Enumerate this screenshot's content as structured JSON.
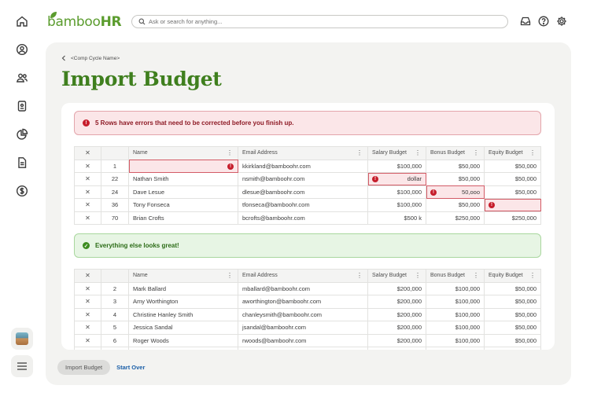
{
  "app": {
    "logo_text": "bamboo",
    "logo_hr": "HR",
    "search_placeholder": "Ask or search for anything..."
  },
  "rail": {
    "icons": [
      "home-icon",
      "person-circle-icon",
      "people-icon",
      "badge-icon",
      "pie-chart-icon",
      "document-icon",
      "dollar-circle-icon"
    ],
    "bottom": [
      "avatar",
      "hamburger-menu-icon"
    ]
  },
  "topbar": {
    "icons": [
      "inbox-icon",
      "help-icon",
      "settings-gear-icon"
    ]
  },
  "breadcrumb": "<Comp Cycle Name>",
  "page_title": "Import Budget",
  "error_alert": "5 Rows have errors that need to be corrected before you finish up.",
  "success_alert": "Everything else looks great!",
  "columns": {
    "name": "Name",
    "email": "Email Address",
    "salary": "Salary Budget",
    "bonus": "Bonus Budget",
    "equity": "Equity Budget"
  },
  "error_rows": [
    {
      "n": "1",
      "name": "",
      "email": "kkirkland@bamboohr.com",
      "salary": "$100,000",
      "bonus": "$50,000",
      "equity": "$50,000"
    },
    {
      "n": "22",
      "name": "Nathan Smith",
      "email": "nsmith@bamboohr.com",
      "salary": "dollar",
      "bonus": "$50,000",
      "equity": "$50,000"
    },
    {
      "n": "24",
      "name": "Dave Lesue",
      "email": "dlesue@bamboohr.com",
      "salary": "$100,000",
      "bonus": "50,ooo",
      "equity": "$50,000"
    },
    {
      "n": "36",
      "name": "Tony Fonseca",
      "email": "tfonseca@bamboohr.com",
      "salary": "$100,000",
      "bonus": "$50,000",
      "equity": ""
    },
    {
      "n": "70",
      "name": "Brian Crofts",
      "email": "bcrofts@bamboohr.com",
      "salary": "$500 k",
      "bonus": "$250,000",
      "equity": "$250,000"
    }
  ],
  "ok_rows": [
    {
      "n": "2",
      "name": "Mark Ballard",
      "email": "mballard@bamboohr.com",
      "salary": "$200,000",
      "bonus": "$100,000",
      "equity": "$50,000"
    },
    {
      "n": "3",
      "name": "Amy Worthington",
      "email": "aworthington@bamboohr.com",
      "salary": "$200,000",
      "bonus": "$100,000",
      "equity": "$50,000"
    },
    {
      "n": "4",
      "name": "Christine Hanley Smith",
      "email": "chanleysmith@bamboohr.com",
      "salary": "$200,000",
      "bonus": "$100,000",
      "equity": "$50,000"
    },
    {
      "n": "5",
      "name": "Jessica Sandal",
      "email": "jsandal@bamboohr.com",
      "salary": "$200,000",
      "bonus": "$100,000",
      "equity": "$50,000"
    },
    {
      "n": "6",
      "name": "Roger Woods",
      "email": "rwoods@bamboohr.com",
      "salary": "$200,000",
      "bonus": "$100,000",
      "equity": "$50,000"
    }
  ],
  "footer": {
    "import_button": "Import Budget",
    "start_over": "Start Over"
  },
  "colors": {
    "brand_green": "#3f7f1e",
    "error_red": "#c61d2b",
    "link_blue": "#1b5fa8"
  }
}
